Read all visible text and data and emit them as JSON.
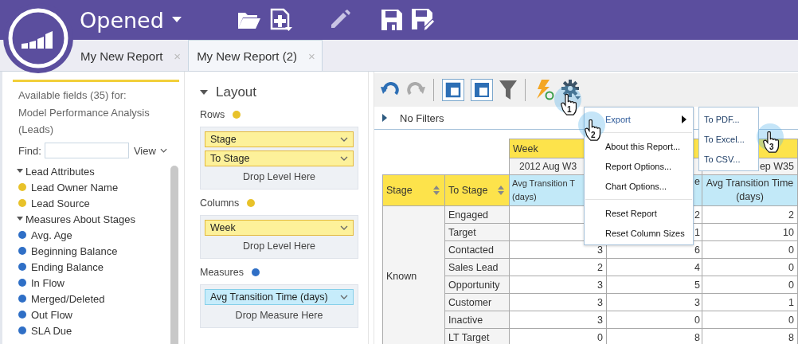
{
  "app": {
    "title": "Opened"
  },
  "tabs": [
    {
      "label": "My New Report",
      "selected": false,
      "close": "×"
    },
    {
      "label": "My New Report (2)",
      "selected": true,
      "close": "×"
    }
  ],
  "fields_panel": {
    "heading": "Available fields (35) for:",
    "subject": "Model Performance Analysis (Leads)",
    "find_label": "Find:",
    "view_label": "View",
    "groups": [
      {
        "label": "Lead Attributes",
        "expanded": true,
        "children": [
          {
            "label": "Lead Owner Name",
            "color": "#e8c22a"
          },
          {
            "label": "Lead Source",
            "color": "#e8c22a"
          }
        ]
      },
      {
        "label": "Measures About Stages",
        "expanded": true,
        "children": [
          {
            "label": "Avg. Age",
            "color": "#2f6fc6"
          },
          {
            "label": "Beginning Balance",
            "color": "#2f6fc6"
          },
          {
            "label": "Ending Balance",
            "color": "#2f6fc6"
          },
          {
            "label": "In Flow",
            "color": "#2f6fc6"
          },
          {
            "label": "Merged/Deleted",
            "color": "#2f6fc6"
          },
          {
            "label": "Out Flow",
            "color": "#2f6fc6"
          },
          {
            "label": "SLA Due",
            "color": "#2f6fc6"
          }
        ]
      }
    ]
  },
  "layout": {
    "title": "Layout",
    "expanded": true,
    "sections": [
      {
        "label": "Rows",
        "color": "#e8c22a",
        "kind": "level",
        "items": [
          "Stage",
          "To Stage"
        ],
        "drop_hint": "Drop Level Here"
      },
      {
        "label": "Columns",
        "color": "#e8c22a",
        "kind": "level",
        "items": [
          "Week"
        ],
        "drop_hint": "Drop Level Here"
      },
      {
        "label": "Measures",
        "color": "#2f6fc6",
        "kind": "measure",
        "items": [
          "Avg Transition Time (days)"
        ],
        "drop_hint": "Drop Measure Here"
      }
    ]
  },
  "report": {
    "toolbar": {
      "undo_disabled": false,
      "redo_disabled": true
    },
    "filter": {
      "label": "No Filters",
      "expanded": false
    },
    "table": {
      "column_dimension": "Week",
      "weeks": [
        "2012 Aug W3",
        "ep W35"
      ],
      "row_headers": [
        "Stage",
        "To Stage"
      ],
      "measure_headers": [
        {
          "line1": "Avg Transition T",
          "line2": "(days)"
        },
        {
          "line1": "e"
        },
        {
          "line1": "Avg Transition Time",
          "line2": "(days)"
        }
      ],
      "stage": "Known",
      "rows": [
        {
          "to_stage": "Engaged",
          "values": [
            "2",
            "2"
          ]
        },
        {
          "to_stage": "Target",
          "values": [
            "1",
            "10"
          ]
        },
        {
          "to_stage": "Contacted",
          "values": [
            "3",
            "6",
            "0"
          ]
        },
        {
          "to_stage": "Sales Lead",
          "values": [
            "2",
            "4",
            "0"
          ]
        },
        {
          "to_stage": "Opportunity",
          "values": [
            "3",
            "5",
            "0"
          ]
        },
        {
          "to_stage": "Customer",
          "values": [
            "3",
            "3",
            "1"
          ]
        },
        {
          "to_stage": "Inactive",
          "values": [
            "3",
            "0",
            "0"
          ]
        },
        {
          "to_stage": "LT Target",
          "values": [
            "0",
            "8",
            "8"
          ]
        }
      ]
    },
    "menu": {
      "items": [
        {
          "kind": "item",
          "label": "Export",
          "submenu": true,
          "highlighted": true
        },
        {
          "kind": "separator"
        },
        {
          "kind": "item",
          "label": "About this Report...",
          "submenu": false,
          "highlighted": false
        },
        {
          "kind": "item",
          "label": "Report Options...",
          "submenu": false,
          "highlighted": false
        },
        {
          "kind": "item",
          "label": "Chart Options...",
          "submenu": false,
          "highlighted": false
        },
        {
          "kind": "separator"
        },
        {
          "kind": "item",
          "label": "Reset Report",
          "submenu": false,
          "highlighted": false
        },
        {
          "kind": "item",
          "label": "Reset Column Sizes",
          "submenu": false,
          "highlighted": false
        }
      ],
      "submenu": [
        "To PDF...",
        "To Excel...",
        "To CSV..."
      ]
    },
    "steps": [
      "1",
      "2",
      "3"
    ]
  }
}
